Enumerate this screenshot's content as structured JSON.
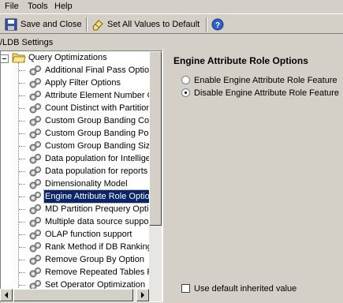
{
  "menu": {
    "file": "File",
    "tools": "Tools",
    "help": "Help"
  },
  "toolbar": {
    "save_close": "Save and Close",
    "set_default": "Set All Values to Default"
  },
  "settings_label": "/LDB Settings",
  "tree": {
    "root": "Query Optimizations",
    "items": [
      "Additional Final Pass Option",
      "Apply Filter Options",
      "Attribute Element Number C",
      "Count Distinct with Partition",
      "Custom Group Banding Cour",
      "Custom Group Banding Poin",
      "Custom Group Banding Size",
      "Data population for Intellige",
      "Data population for reports",
      "Dimensionality Model",
      "Engine Attribute Role Optio",
      "MD Partition Prequery Optic",
      "Multiple data source suppor",
      "OLAP function support",
      "Rank Method if DB Ranking",
      "Remove Group By Option",
      "Remove Repeated Tables F",
      "Set Operator Optimization"
    ],
    "selected_index": 10
  },
  "panel": {
    "title": "Engine Attribute Role Options",
    "options": [
      "Enable Engine Attribute Role Feature",
      "Disable Engine Attribute Role Feature"
    ],
    "selected_option": 1,
    "default_checkbox": "Use default inherited value"
  }
}
